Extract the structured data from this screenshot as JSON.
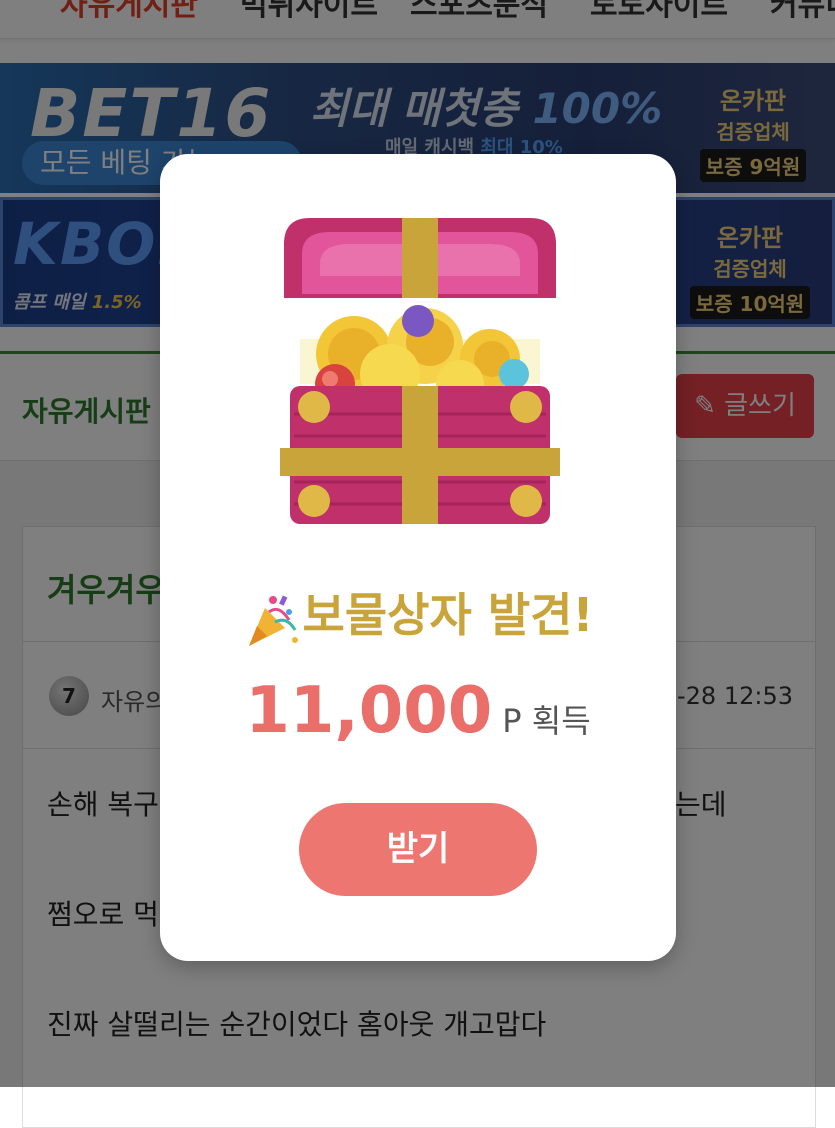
{
  "nav": {
    "items": [
      "자유게시판",
      "먹튀사이트",
      "스포츠분석",
      "토토사이트",
      "커뮤니티"
    ]
  },
  "banner1": {
    "logo": "BET16",
    "headline": "최대 매첫충 ",
    "headline_highlight": "100%",
    "sub": "매일 캐시백 ",
    "sub_highlight": "최대 10%",
    "pill": "모든 베팅 가능",
    "badge_line1": "온카판",
    "badge_line2": "검증업체",
    "badge_line3": "보증 9억원"
  },
  "banner2": {
    "logo": "KBO.",
    "sub": "콤프 매일 ",
    "sub_highlight": "1.5%",
    "badge_line1": "온카판",
    "badge_line2": "검증업체",
    "badge_line3": "보증 10억원"
  },
  "board": {
    "title": "자유게시판",
    "write_button": "글쓰기"
  },
  "post": {
    "title": "겨우겨우",
    "level": "7",
    "author": "자유의",
    "date": "6-28 12:53",
    "lines": [
      "손해 복구",
      "는데",
      "쩜오로 먹",
      "진짜 살떨리는 순간이었다 홈아웃 개고맙다"
    ]
  },
  "modal": {
    "title": "보물상자 발견!",
    "points": "11,000",
    "unit": "P 획득",
    "button": "받기"
  },
  "colors": {
    "accent_title": "#c9a43a",
    "points": "#ea6f6a",
    "button": "#ee7670",
    "board_green": "#2d7a2d",
    "write_button": "#e8404a"
  }
}
